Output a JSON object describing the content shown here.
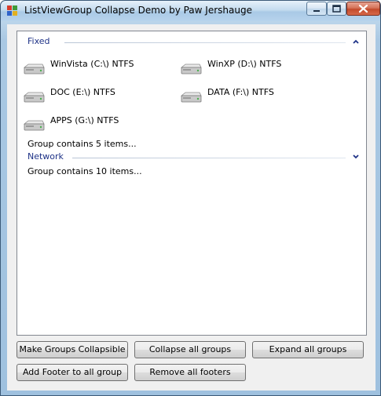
{
  "window": {
    "title": "ListViewGroup Collapse Demo by Paw Jershauge"
  },
  "titlebar": {
    "app_icon": "app-icon",
    "controls": [
      "minimize-icon",
      "maximize-icon",
      "close-icon"
    ]
  },
  "listview": {
    "groups": [
      {
        "header": "Fixed",
        "state_icon": "chevron-up-icon",
        "items": [
          {
            "label": "WinVista (C:\\) NTFS",
            "icon": "drive-icon"
          },
          {
            "label": "WinXP (D:\\) NTFS",
            "icon": "drive-icon"
          },
          {
            "label": "DOC (E:\\) NTFS",
            "icon": "drive-icon"
          },
          {
            "label": "DATA (F:\\) NTFS",
            "icon": "drive-icon"
          },
          {
            "label": "APPS (G:\\) NTFS",
            "icon": "drive-icon"
          }
        ],
        "footer": "Group contains 5 items..."
      },
      {
        "header": "Network",
        "state_icon": "chevron-down-icon",
        "items": [],
        "footer": "Group contains 10 items..."
      }
    ]
  },
  "buttons": {
    "make_collapsible": "Make Groups Collapsible",
    "collapse_all": "Collapse all groups",
    "expand_all": "Expand all groups",
    "add_footer": "Add Footer to all group",
    "remove_footers": "Remove all footers"
  },
  "colors": {
    "group_header": "#1e3287",
    "client_background": "#f0f0f0",
    "close_button": "#c24a2c"
  }
}
